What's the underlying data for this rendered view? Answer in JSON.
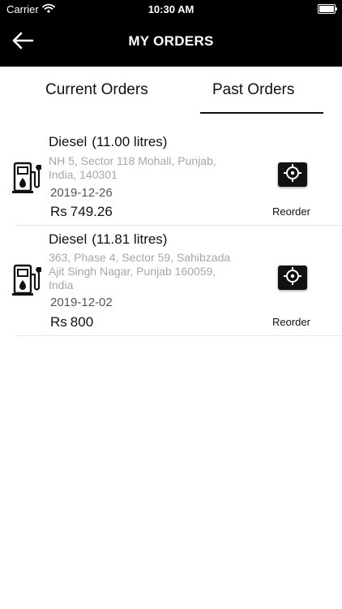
{
  "status_bar": {
    "carrier": "Carrier",
    "time": "10:30 AM"
  },
  "header": {
    "title": "MY ORDERS"
  },
  "tabs": [
    {
      "label": "Current Orders",
      "selected": false
    },
    {
      "label": "Past Orders",
      "selected": true
    }
  ],
  "orders": [
    {
      "product": "Diesel",
      "quantity": "(11.00 litres)",
      "address": "NH 5, Sector 118 Mohali, Punjab, India, 140301",
      "date": "2019-12-26",
      "currency": "Rs",
      "amount": "749.26",
      "action": "Reorder"
    },
    {
      "product": "Diesel",
      "quantity": "(11.81 litres)",
      "address": "363, Phase 4, Sector 59, Sahibzada Ajit Singh Nagar, Punjab 160059, India",
      "date": "2019-12-02",
      "currency": "Rs",
      "amount": "800",
      "action": "Reorder"
    }
  ],
  "icons": {
    "back": "arrow-left-icon",
    "fuel": "fuel-pump-icon",
    "locate": "crosshair-icon",
    "wifi": "wifi-icon",
    "battery": "battery-icon"
  },
  "colors": {
    "header_bg": "#000000",
    "address_text": "#a7a7a7",
    "divider": "#e5e5e5"
  }
}
